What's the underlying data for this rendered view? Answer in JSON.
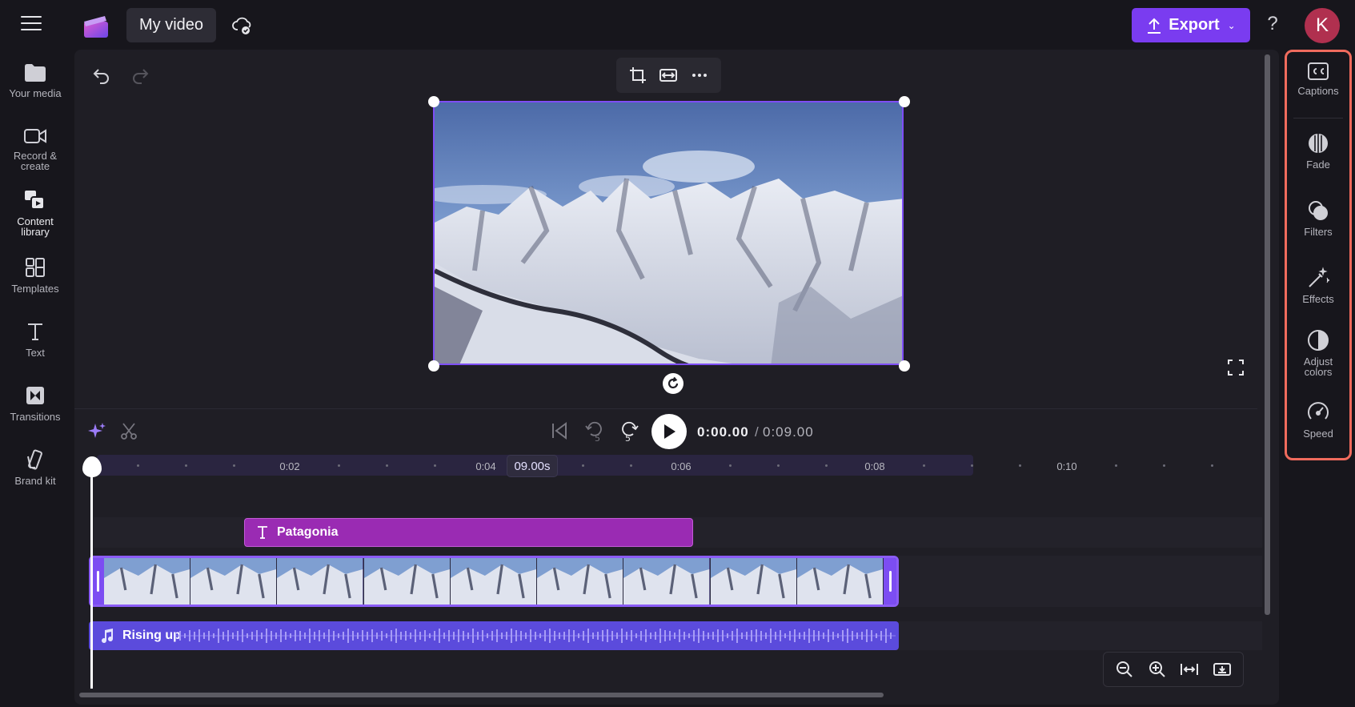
{
  "app": {
    "title": "My video",
    "export_label": "Export",
    "help_label": "?",
    "avatar_initial": "K"
  },
  "left_nav": {
    "items": [
      {
        "label": "Your media",
        "icon": "folder-icon"
      },
      {
        "label": "Record &\ncreate",
        "icon": "camera-icon"
      },
      {
        "label": "Content\nlibrary",
        "icon": "content-library-icon"
      },
      {
        "label": "Templates",
        "icon": "templates-icon"
      },
      {
        "label": "Text",
        "icon": "text-icon"
      },
      {
        "label": "Transitions",
        "icon": "transitions-icon"
      },
      {
        "label": "Brand kit",
        "icon": "brand-kit-icon"
      }
    ]
  },
  "right_panel": {
    "items": [
      {
        "label": "Captions",
        "icon": "captions-icon"
      },
      {
        "label": "Fade",
        "icon": "fade-icon"
      },
      {
        "label": "Filters",
        "icon": "filters-icon"
      },
      {
        "label": "Effects",
        "icon": "effects-icon"
      },
      {
        "label": "Adjust\ncolors",
        "icon": "adjust-colors-icon"
      },
      {
        "label": "Speed",
        "icon": "speed-icon"
      }
    ],
    "highlight_color": "#f06b5d"
  },
  "playback": {
    "current_time": "0:00.00",
    "separator": "/",
    "total_time": "0:09.00",
    "skip_label": "5"
  },
  "timeline": {
    "ticks": [
      "0:02",
      "0:04",
      "0:06",
      "0:08",
      "0:10"
    ],
    "marker_label": "09.00s",
    "text_clip_label": "Patagonia",
    "audio_clip_label": "Rising up"
  },
  "colors": {
    "accent": "#7a3cf0",
    "text_clip": "#9a2bb3",
    "audio_clip": "#5b4bdc",
    "video_clip_border": "#8b5cf6"
  }
}
